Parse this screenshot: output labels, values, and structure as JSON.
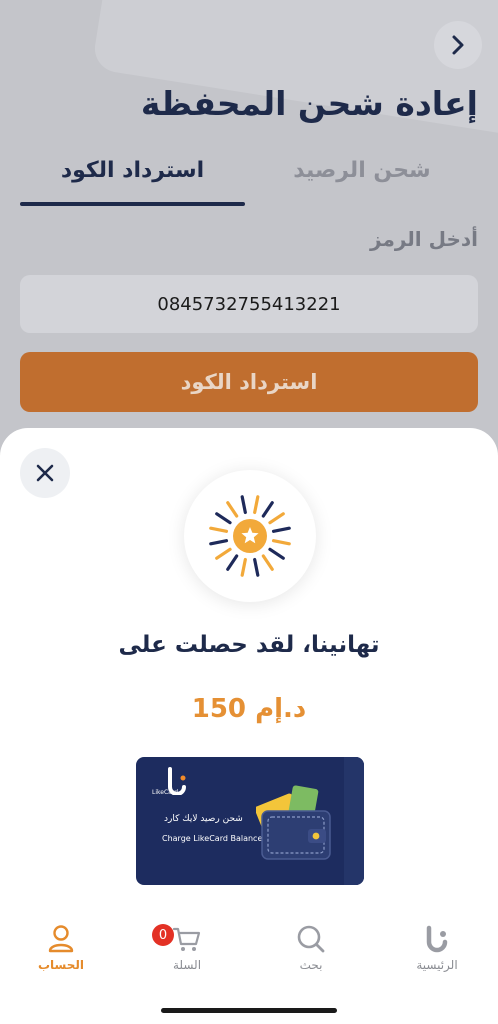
{
  "page": {
    "title": "إعادة شحن المحفظة",
    "back_icon": "chevron-right-icon"
  },
  "tabs": {
    "charge_balance": "شحن الرصيد",
    "redeem_code": "استرداد الكود",
    "active": "redeem_code"
  },
  "form": {
    "code_label": "أدخل الرمز",
    "code_value": "0845732755413221",
    "submit_label": "استرداد الكود"
  },
  "modal": {
    "close_icon": "close-icon",
    "success_icon": "star-sun-icon",
    "congrats_text": "تهانينا، لقد حصلت على",
    "amount_text": "150 د.إم",
    "card": {
      "brand": "LikeCard",
      "title_ar": "شحن رصيد لايك كارد",
      "title_en": "Charge LikeCard Balance"
    }
  },
  "tabbar": {
    "items": [
      {
        "label": "الرئيسية",
        "icon": "home-logo-icon"
      },
      {
        "label": "بحث",
        "icon": "search-icon"
      },
      {
        "label": "السلة",
        "icon": "cart-icon",
        "badge": "0"
      },
      {
        "label": "الحساب",
        "icon": "user-icon",
        "active": true
      }
    ]
  },
  "colors": {
    "primary": "#1e2a4a",
    "accent": "#e58b2c",
    "button": "#c06e2f",
    "badge": "#e33125",
    "card": "#1d2c5f"
  }
}
